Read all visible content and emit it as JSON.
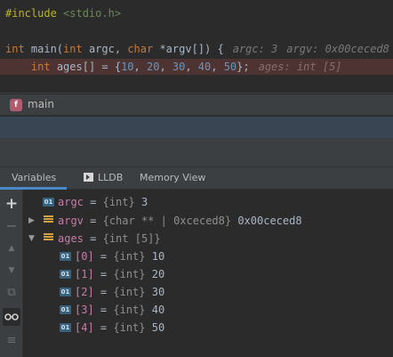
{
  "editor": {
    "line1": {
      "directive": "#include",
      "header": "<stdio.h>"
    },
    "line2": {
      "t_int": "int",
      "fn": " main(",
      "t_int2": "int",
      "argc": " argc, ",
      "t_char": "char",
      "argv": " *argv[]) {",
      "hint1": "argc: 3",
      "hint2": "argv: 0x00ceced8"
    },
    "line3": {
      "t_int": "int",
      "decl": " ages[] = {",
      "n1": "10",
      "n2": "20",
      "n3": "30",
      "n4": "40",
      "n5": "50",
      "sep": ", ",
      "end": "};",
      "hint": "ages: int [5]"
    }
  },
  "frames": {
    "badge": "f",
    "current": "main"
  },
  "tabs": [
    {
      "label": "Variables",
      "active": true
    },
    {
      "label": "LLDB",
      "active": false
    },
    {
      "label": "Memory View",
      "active": false
    }
  ],
  "variables": {
    "argc": {
      "name": "argc",
      "eq": " = ",
      "type": "{int}",
      "value": " 3",
      "icon": "01"
    },
    "argv": {
      "name": "argv",
      "eq": " = ",
      "type": "{char ** | 0xceced8}",
      "value": " 0x00ceced8"
    },
    "ages": {
      "name": "ages",
      "eq": " = ",
      "type": "{int [5]}"
    },
    "elements": [
      {
        "name": "[0]",
        "eq": " = ",
        "type": "{int}",
        "value": " 10",
        "icon": "01"
      },
      {
        "name": "[1]",
        "eq": " = ",
        "type": "{int}",
        "value": " 20",
        "icon": "01"
      },
      {
        "name": "[2]",
        "eq": " = ",
        "type": "{int}",
        "value": " 30",
        "icon": "01"
      },
      {
        "name": "[3]",
        "eq": " = ",
        "type": "{int}",
        "value": " 40",
        "icon": "01"
      },
      {
        "name": "[4]",
        "eq": " = ",
        "type": "{int}",
        "value": " 50",
        "icon": "01"
      }
    ]
  },
  "toolbar": {
    "add": "+",
    "remove": "−",
    "up": "▲",
    "down": "▼",
    "copy": "⧉",
    "watch": "👓",
    "layout": "≡"
  },
  "colors": {
    "exec_line": "#4e3333",
    "tab_active": "#4a88c7",
    "badge": "#b15b6e",
    "number": "#6897bb",
    "keyword": "#cc7832",
    "var_name": "#c67ca8"
  }
}
